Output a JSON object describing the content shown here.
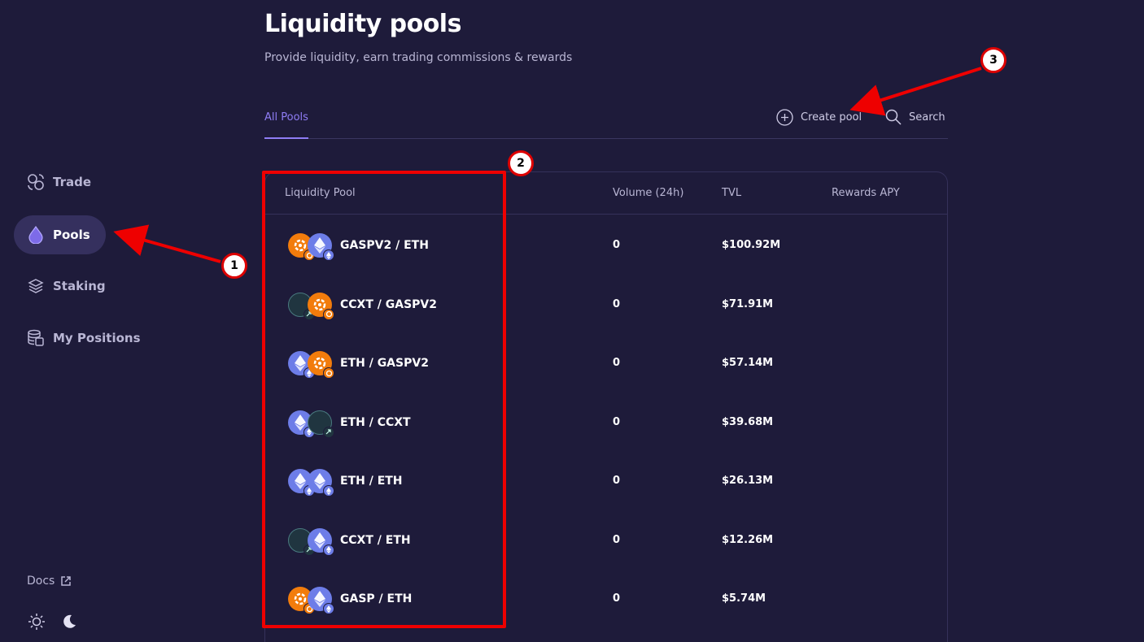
{
  "sidebar": {
    "items": [
      {
        "label": "Trade",
        "icon": "trade-icon"
      },
      {
        "label": "Pools",
        "icon": "droplet-icon",
        "active": true
      },
      {
        "label": "Staking",
        "icon": "layers-icon"
      },
      {
        "label": "My Positions",
        "icon": "database-icon"
      }
    ],
    "docs_label": "Docs"
  },
  "header": {
    "title": "Liquidity pools",
    "subtitle": "Provide liquidity, earn trading commissions & rewards"
  },
  "tabs": {
    "all_pools": "All Pools",
    "create_pool": "Create pool",
    "search": "Search"
  },
  "table": {
    "columns": [
      "Liquidity Pool",
      "Volume (24h)",
      "TVL",
      "Rewards APY"
    ],
    "rows": [
      {
        "pair": "GASPV2 / ETH",
        "volume": "0",
        "tvl": "$100.92M",
        "a": "gasp",
        "b": "eth"
      },
      {
        "pair": "CCXT / GASPV2",
        "volume": "0",
        "tvl": "$71.91M",
        "a": "ccxt",
        "b": "gasp"
      },
      {
        "pair": "ETH / GASPV2",
        "volume": "0",
        "tvl": "$57.14M",
        "a": "eth",
        "b": "gasp"
      },
      {
        "pair": "ETH / CCXT",
        "volume": "0",
        "tvl": "$39.68M",
        "a": "eth",
        "b": "ccxt"
      },
      {
        "pair": "ETH / ETH",
        "volume": "0",
        "tvl": "$26.13M",
        "a": "eth",
        "b": "eth"
      },
      {
        "pair": "CCXT / ETH",
        "volume": "0",
        "tvl": "$12.26M",
        "a": "ccxt",
        "b": "eth"
      },
      {
        "pair": "GASP / ETH",
        "volume": "0",
        "tvl": "$5.74M",
        "a": "gasp",
        "b": "eth"
      }
    ]
  },
  "annotations": [
    "1",
    "2",
    "3"
  ],
  "colors": {
    "background": "#1e1b3a",
    "accent": "#8f7df5",
    "active_nav": "#35305e",
    "annotation": "#ee0000"
  }
}
